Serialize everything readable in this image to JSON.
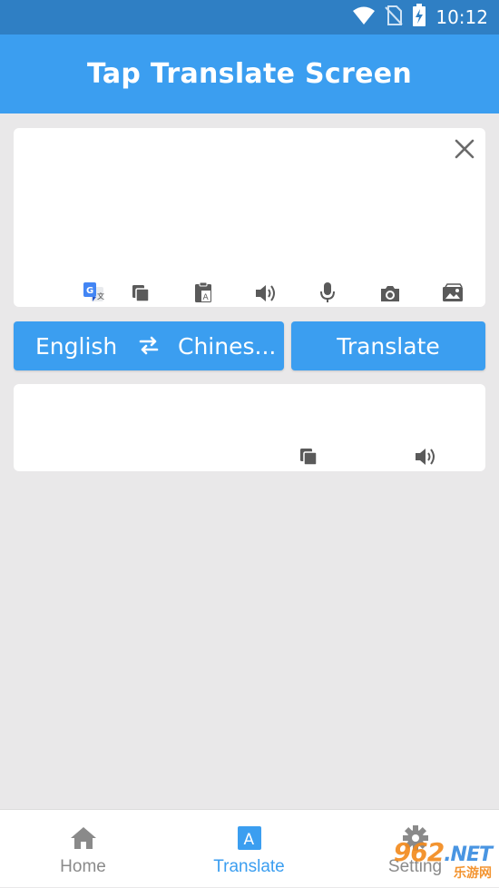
{
  "status_bar": {
    "time": "10:12",
    "icons": [
      "wifi-icon",
      "no-sim-icon",
      "battery-charging-icon"
    ]
  },
  "app_bar": {
    "title": "Tap Translate Screen"
  },
  "input_card": {
    "text": "",
    "tools": [
      "google-translate-icon",
      "copy-icon",
      "paste-icon",
      "speaker-icon",
      "microphone-icon",
      "camera-icon",
      "gallery-icon"
    ]
  },
  "language_selector": {
    "source": "English",
    "target": "Chines..."
  },
  "translate_button": {
    "label": "Translate"
  },
  "output_card": {
    "text": "",
    "tools": [
      "copy-icon",
      "speaker-icon"
    ]
  },
  "bottom_nav": {
    "items": [
      {
        "label": "Home",
        "icon": "home-icon",
        "active": false
      },
      {
        "label": "Translate",
        "icon": "translate-icon",
        "active": true
      },
      {
        "label": "Setting",
        "icon": "gear-icon",
        "active": false
      }
    ]
  },
  "watermark": {
    "brand": "962",
    "tld": ".NET",
    "sub": "乐游网"
  },
  "colors": {
    "primary": "#3b9ef0",
    "status_bar": "#2f7fc4",
    "icon_gray": "#5a5a5a",
    "inactive_label": "#8a8a8a",
    "background": "#e9e8e9"
  }
}
